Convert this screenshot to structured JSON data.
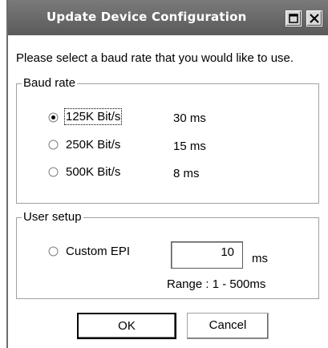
{
  "window": {
    "title": "Update Device Configuration",
    "titlebar_buttons": [
      "restore-icon",
      "close-icon"
    ]
  },
  "prompt": "Please select a baud rate that you would like to use.",
  "baud_group": {
    "title": "Baud rate",
    "options": [
      {
        "label": "125K Bit/s",
        "time": "30 ms",
        "selected": true
      },
      {
        "label": "250K Bit/s",
        "time": "15 ms",
        "selected": false
      },
      {
        "label": "500K Bit/s",
        "time": "8 ms",
        "selected": false
      }
    ]
  },
  "user_group": {
    "title": "User setup",
    "option_label": "Custom EPI",
    "option_selected": false,
    "value": "10",
    "unit": "ms",
    "range": "Range : 1 - 500ms"
  },
  "buttons": {
    "ok": "OK",
    "cancel": "Cancel"
  },
  "colors": {
    "titlebar": "#6a6a6a",
    "title_text": "#ffffff",
    "background": "#ffffff"
  }
}
